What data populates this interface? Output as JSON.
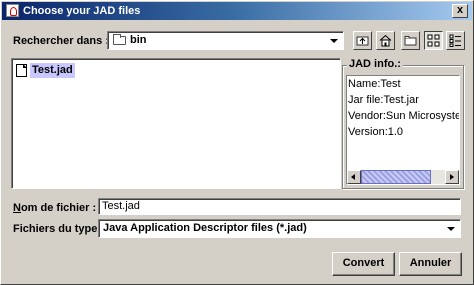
{
  "window": {
    "title": "Choose your JAD files",
    "close_label": "x"
  },
  "lookin": {
    "label": "Rechercher dans :",
    "value": "bin"
  },
  "toolbar": {
    "buttons": [
      "up-one-level-icon",
      "home-icon",
      "new-folder-icon",
      "list-view-icon",
      "details-view-icon"
    ]
  },
  "files": [
    {
      "name": "Test.jad",
      "icon": "document-icon",
      "selected": true
    }
  ],
  "jad_info": {
    "legend": "JAD info.:",
    "lines": [
      "Name:Test",
      "Jar file:Test.jar",
      "Vendor:Sun Microsystem",
      "Version:1.0"
    ]
  },
  "filename": {
    "label_first": "N",
    "label_rest": "om de fichier :",
    "value": "Test.jad"
  },
  "filetype": {
    "label": "Fichiers du type :",
    "value": "Java Application Descriptor files (*.jad)"
  },
  "buttons": {
    "convert": "Convert",
    "cancel": "Annuler"
  },
  "colors": {
    "window_bg": "#d4d0c8",
    "selection": "#c8c8ff",
    "titlebar": "#0a246a"
  }
}
